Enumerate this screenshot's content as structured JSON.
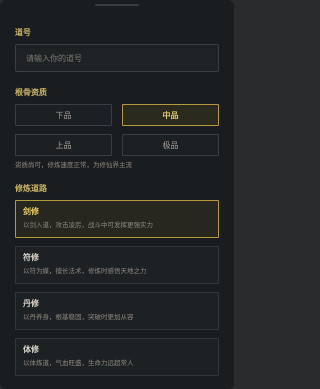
{
  "dao": {
    "label": "道号",
    "placeholder": "请输入你的道号"
  },
  "root": {
    "label": "根骨资质",
    "options": [
      {
        "label": "下品",
        "selected": false
      },
      {
        "label": "中品",
        "selected": true
      },
      {
        "label": "上品",
        "selected": false
      },
      {
        "label": "极品",
        "selected": false
      }
    ],
    "description": "资质尚可，修炼速度正常，为修仙界主流"
  },
  "path": {
    "label": "修炼道路",
    "options": [
      {
        "title": "剑修",
        "desc": "以剑入道，攻击凌厉，战斗中可发挥更强实力",
        "selected": true
      },
      {
        "title": "符修",
        "desc": "以符为媒，擅长法术，修炼时感悟天地之力",
        "selected": false
      },
      {
        "title": "丹修",
        "desc": "以丹养身，根基稳固，突破时更加从容",
        "selected": false
      },
      {
        "title": "体修",
        "desc": "以体炼道，气血旺盛，生命力远超常人",
        "selected": false
      }
    ]
  },
  "colors": {
    "accent": "#c9b168",
    "selected_border": "#b49a3f",
    "background": "#1a1d1f"
  }
}
